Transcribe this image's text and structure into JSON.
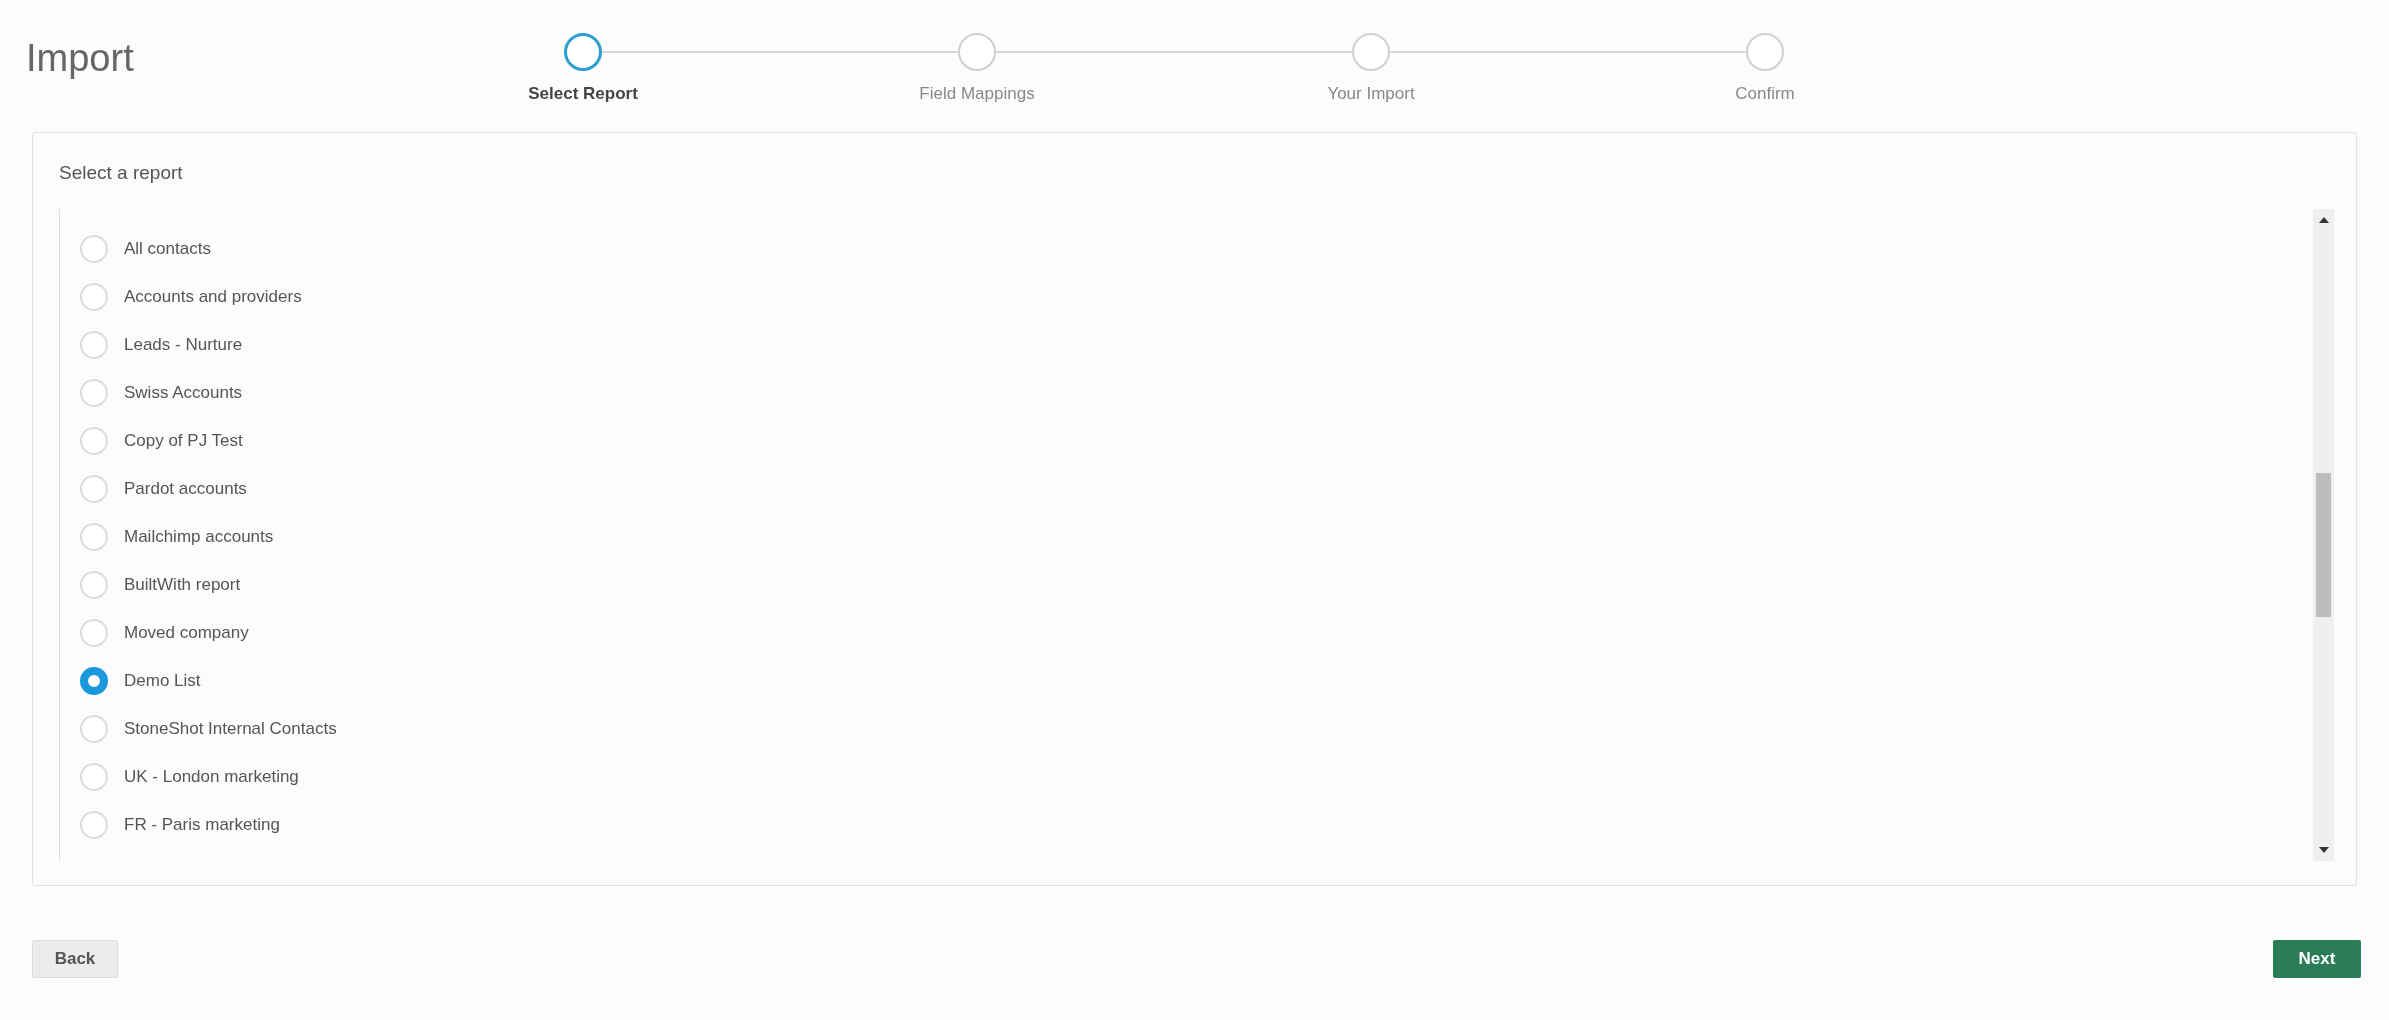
{
  "title": "Import",
  "steps": [
    {
      "label": "Select Report",
      "selected": true
    },
    {
      "label": "Field Mappings",
      "selected": false
    },
    {
      "label": "Your Import",
      "selected": false
    },
    {
      "label": "Confirm",
      "selected": false
    }
  ],
  "panel": {
    "heading": "Select a report",
    "reports": [
      {
        "label": "All contacts",
        "selected": false
      },
      {
        "label": "Accounts and providers",
        "selected": false
      },
      {
        "label": "Leads - Nurture",
        "selected": false
      },
      {
        "label": "Swiss Accounts",
        "selected": false
      },
      {
        "label": "Copy of PJ Test",
        "selected": false
      },
      {
        "label": "Pardot accounts",
        "selected": false
      },
      {
        "label": "Mailchimp accounts",
        "selected": false
      },
      {
        "label": "BuiltWith report",
        "selected": false
      },
      {
        "label": "Moved company",
        "selected": false
      },
      {
        "label": "Demo List",
        "selected": true
      },
      {
        "label": "StoneShot Internal Contacts",
        "selected": false
      },
      {
        "label": "UK - London marketing",
        "selected": false
      },
      {
        "label": "FR - Paris marketing",
        "selected": false
      }
    ]
  },
  "buttons": {
    "back": "Back",
    "next": "Next"
  }
}
